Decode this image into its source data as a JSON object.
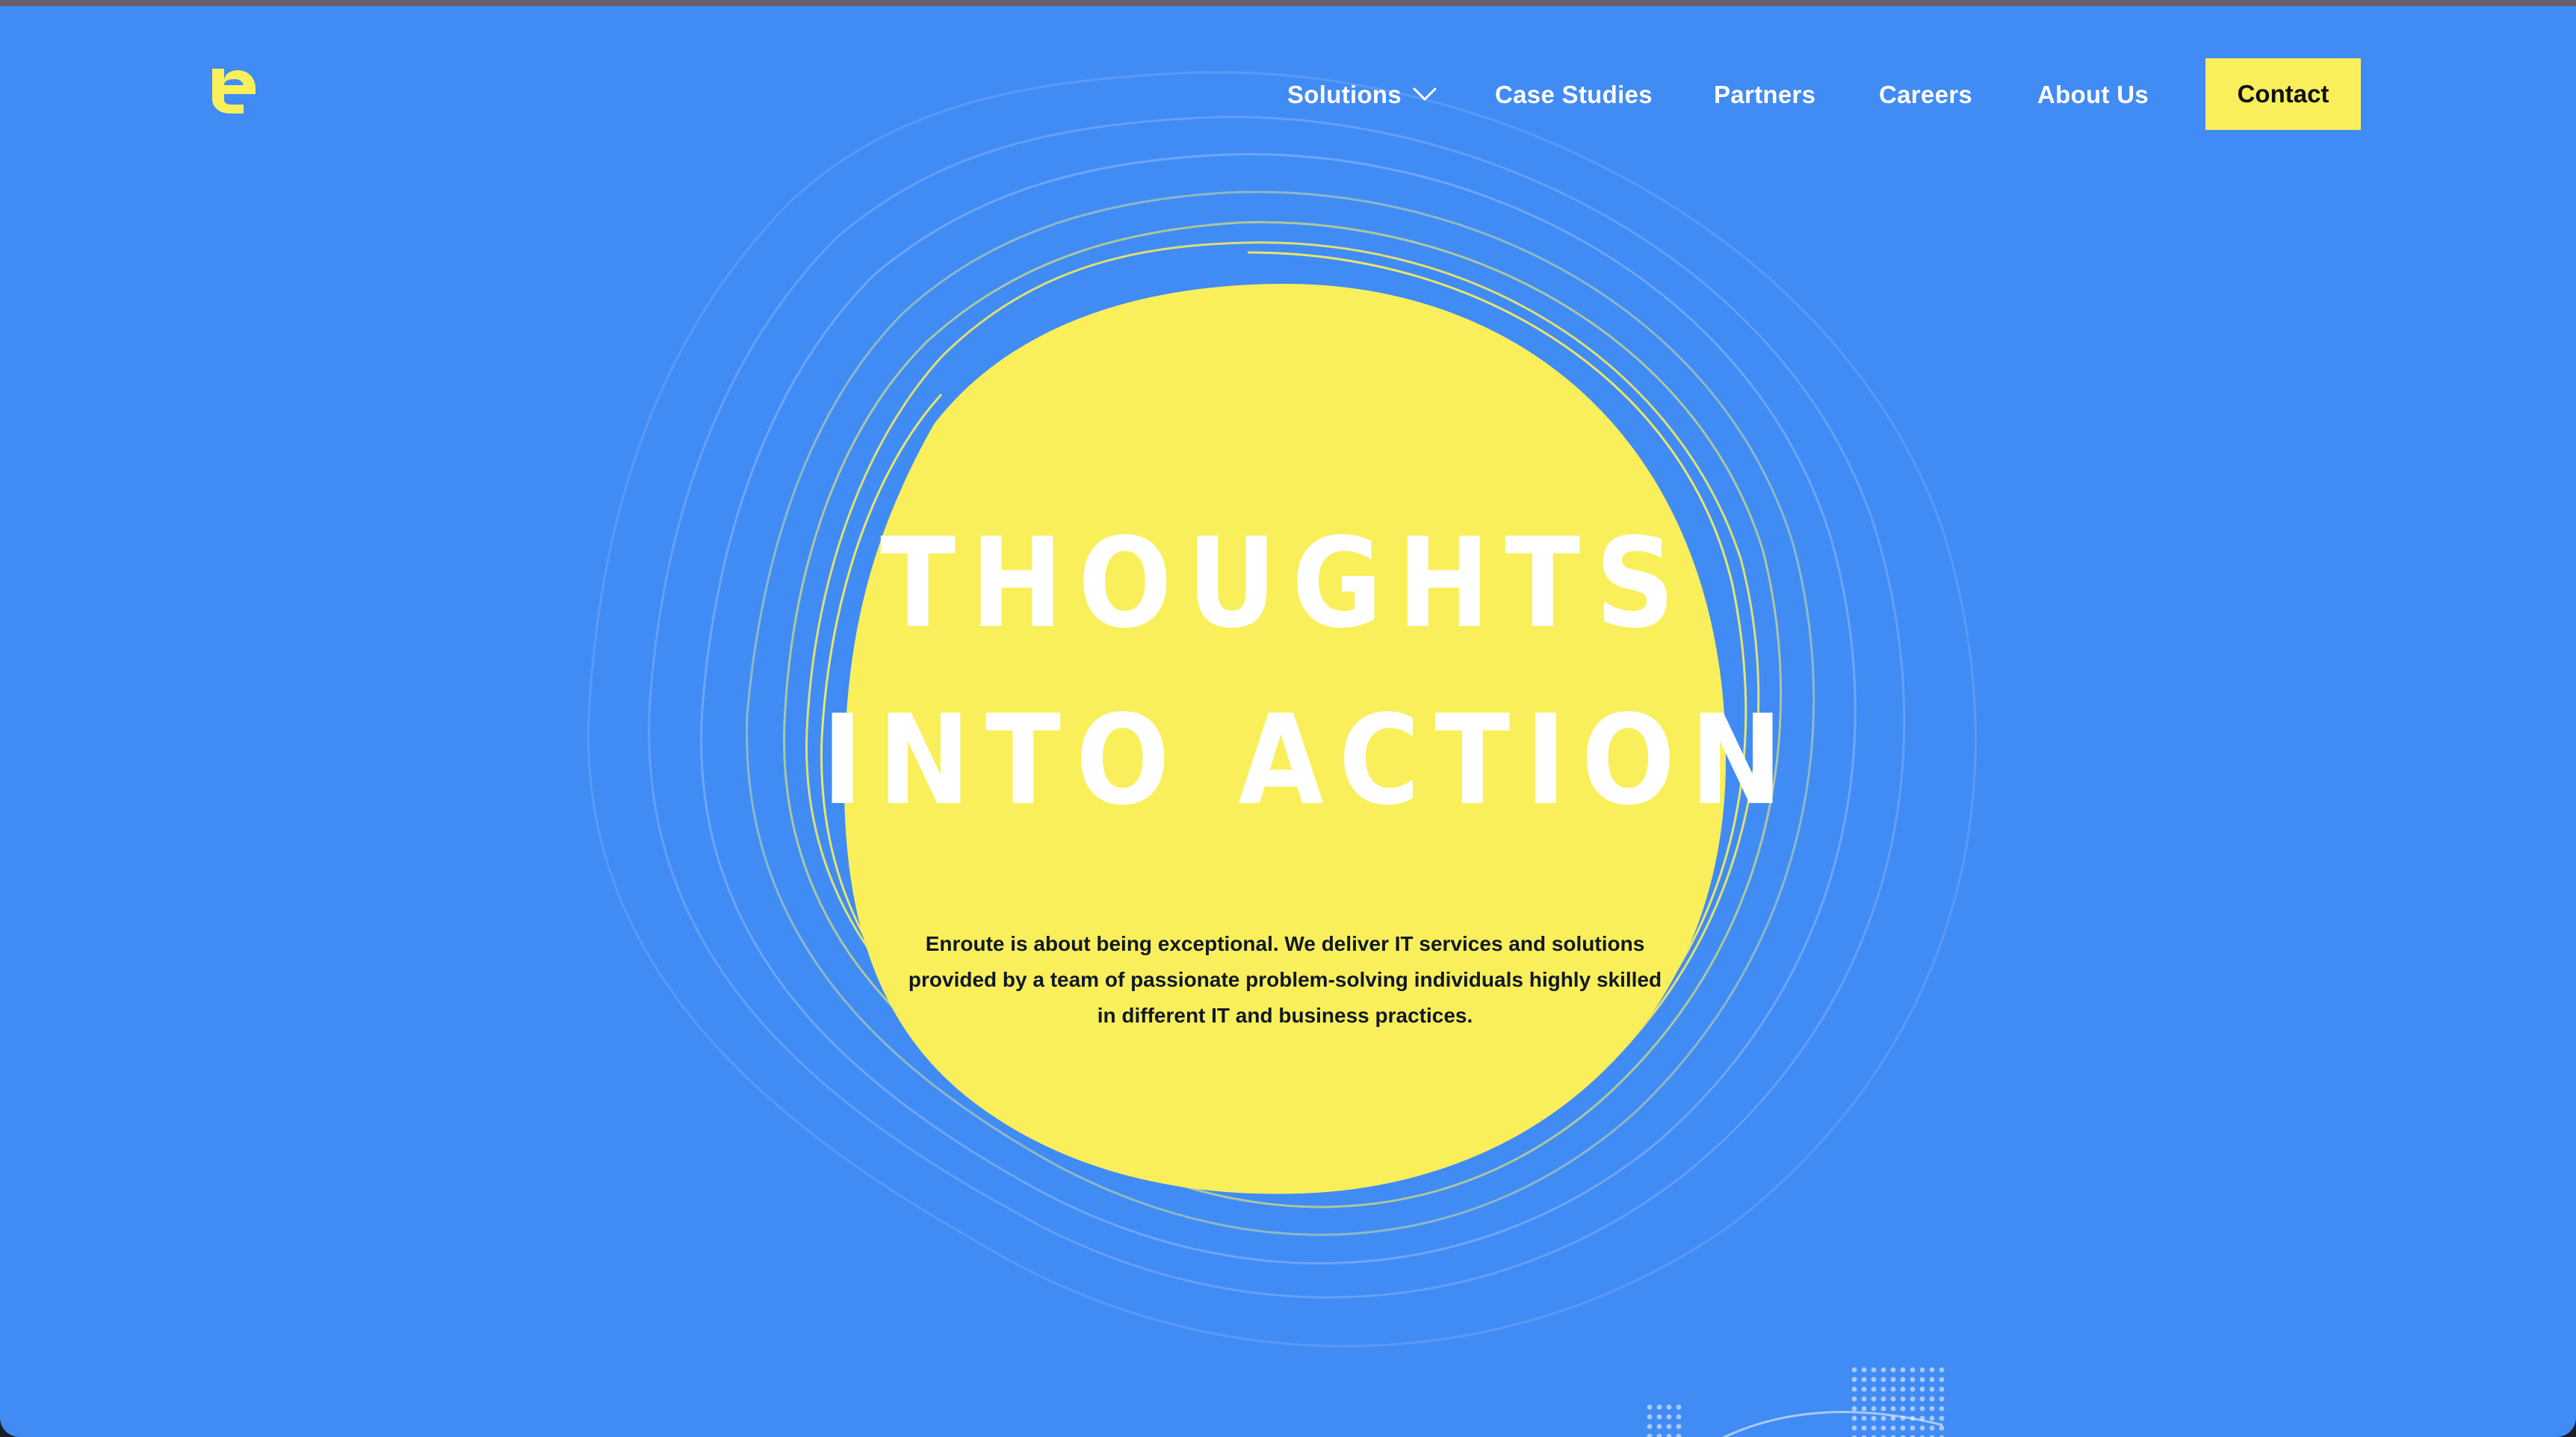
{
  "brand": {
    "logo_icon": "enroute-logo-icon",
    "logo_color": "#f9ef5b"
  },
  "nav": {
    "items": [
      {
        "label": "Solutions",
        "has_dropdown": true,
        "dropdown_icon": "chevron-down-icon"
      },
      {
        "label": "Case Studies"
      },
      {
        "label": "Partners"
      },
      {
        "label": "Careers"
      },
      {
        "label": "About Us"
      }
    ],
    "contact_label": "Contact"
  },
  "hero": {
    "headline_line1": "THOUGHTS",
    "headline_line2": "INTO ACTION",
    "description": "Enroute is about being exceptional. We deliver IT services and solutions provided by a team of passionate problem-solving individuals highly skilled in different IT and business practices."
  },
  "colors": {
    "background": "#418bf5",
    "accent_yellow": "#f9ef5b",
    "text_dark": "#111827",
    "text_light": "#ffffff"
  }
}
